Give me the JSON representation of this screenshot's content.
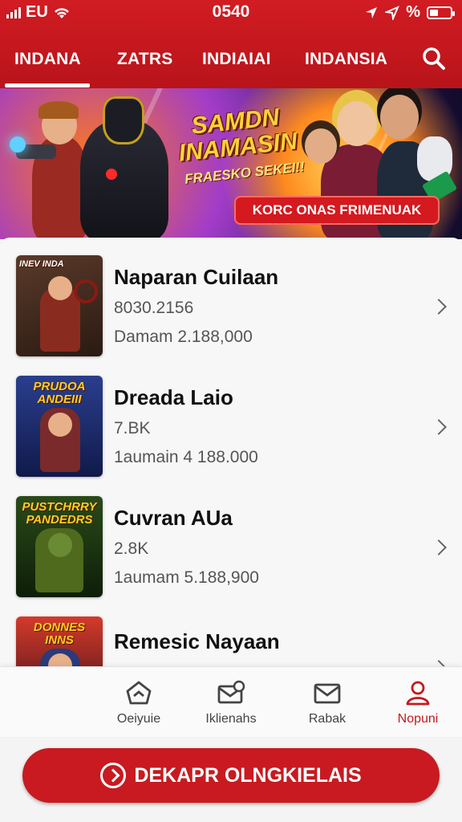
{
  "status_bar": {
    "carrier": "EU",
    "time": "0540",
    "battery_text": "%"
  },
  "tabs": [
    {
      "label": "INDANA",
      "active": true
    },
    {
      "label": "ZATRS"
    },
    {
      "label": "INDIAIAI"
    },
    {
      "label": "INDANSIA"
    }
  ],
  "banner": {
    "title": "SAMDN INAMASIN",
    "subtitle": "FRAESKO SEKEI!!",
    "button_label": "KORC ONAS  FRIMENUAK"
  },
  "games": [
    {
      "thumb_label": "INEV INDA",
      "title": "Naparan Cuilaan",
      "line2": "8030.2156",
      "line3": "Damam  2.188,000",
      "colors": [
        "#3a2a1e",
        "#8a2b20"
      ]
    },
    {
      "thumb_label": "PRUDOA ANDEIII",
      "title": "Dreada Laio",
      "line2": "7.BK",
      "line3": "1aumain 4 188.000",
      "colors": [
        "#1c2f6e",
        "#3a4fb2"
      ]
    },
    {
      "thumb_label": "PUSTCHRRY PANDEDRS",
      "title": "Cuvran AUa",
      "line2": "2.8K",
      "line3": "1aumam  5.188,900",
      "colors": [
        "#1b3a12",
        "#4f7a1c"
      ]
    },
    {
      "thumb_label": "DONNES INNS",
      "title": "Remesic Nayaan",
      "line2": "",
      "line3": "",
      "colors": [
        "#6a1a28",
        "#d43a2a"
      ]
    }
  ],
  "bottom_nav": [
    {
      "label": "Oeiyuie",
      "icon": "home-icon"
    },
    {
      "label": "Iklienahs",
      "icon": "mail-gift-icon"
    },
    {
      "label": "Rabak",
      "icon": "envelope-icon"
    },
    {
      "label": "Nopuni",
      "icon": "profile-icon",
      "active": true
    }
  ],
  "cta_label": "DEKAPR OLNGKIELAIS",
  "colors": {
    "primary": "#c8161d",
    "active_nav": "#c4191f"
  }
}
